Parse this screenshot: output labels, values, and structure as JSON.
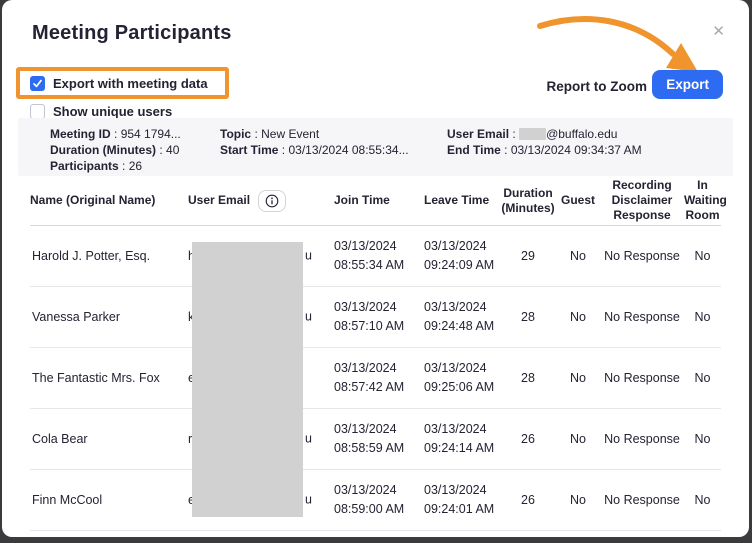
{
  "dialog": {
    "title": "Meeting Participants",
    "close_glyph": "✕"
  },
  "filters": {
    "export_with_meeting_data": {
      "label": "Export with meeting data",
      "checked": true
    },
    "show_unique_users": {
      "label": "Show unique users",
      "checked": false
    }
  },
  "actions": {
    "report_link": "Report to Zoom",
    "export_button": "Export"
  },
  "meeting_info": {
    "meeting_id_label": "Meeting ID",
    "meeting_id_value": "954 1794...",
    "duration_label": "Duration (Minutes)",
    "duration_value": "40",
    "participants_label": "Participants",
    "participants_value": "26",
    "topic_label": "Topic",
    "topic_value": "New Event",
    "start_label": "Start Time",
    "start_value": "03/13/2024 08:55:34...",
    "email_label": "User Email",
    "email_domain": "@buffalo.edu",
    "end_label": "End Time",
    "end_value": "03/13/2024 09:34:37 AM"
  },
  "table": {
    "columns": [
      "Name (Original Name)",
      "User Email",
      "Join Time",
      "Leave Time",
      "Duration (Minutes)",
      "Guest",
      "Recording Disclaimer Response",
      "In Waiting Room"
    ],
    "rows": [
      {
        "name": "Harold J. Potter, Esq.",
        "email_left": "h",
        "email_right": "u",
        "join": "03/13/2024 08:55:34 AM",
        "leave": "03/13/2024 09:24:09 AM",
        "duration": "29",
        "guest": "No",
        "recording": "No Response",
        "waiting": "No"
      },
      {
        "name": "Vanessa Parker",
        "email_left": "k",
        "email_right": "u",
        "join": "03/13/2024 08:57:10 AM",
        "leave": "03/13/2024 09:24:48 AM",
        "duration": "28",
        "guest": "No",
        "recording": "No Response",
        "waiting": "No"
      },
      {
        "name": "The Fantastic Mrs. Fox",
        "email_left": "e",
        "email_right": "",
        "join": "03/13/2024 08:57:42 AM",
        "leave": "03/13/2024 09:25:06 AM",
        "duration": "28",
        "guest": "No",
        "recording": "No Response",
        "waiting": "No"
      },
      {
        "name": "Cola Bear",
        "email_left": "r",
        "email_right": "u",
        "join": "03/13/2024 08:58:59 AM",
        "leave": "03/13/2024 09:24:14 AM",
        "duration": "26",
        "guest": "No",
        "recording": "No Response",
        "waiting": "No"
      },
      {
        "name": "Finn McCool",
        "email_left": "e",
        "email_right": "u",
        "join": "03/13/2024 08:59:00 AM",
        "leave": "03/13/2024 09:24:01 AM",
        "duration": "26",
        "guest": "No",
        "recording": "No Response",
        "waiting": "No"
      }
    ]
  },
  "colors": {
    "accent_blue": "#2d6cf2",
    "annotation_orange": "#f0942d"
  }
}
